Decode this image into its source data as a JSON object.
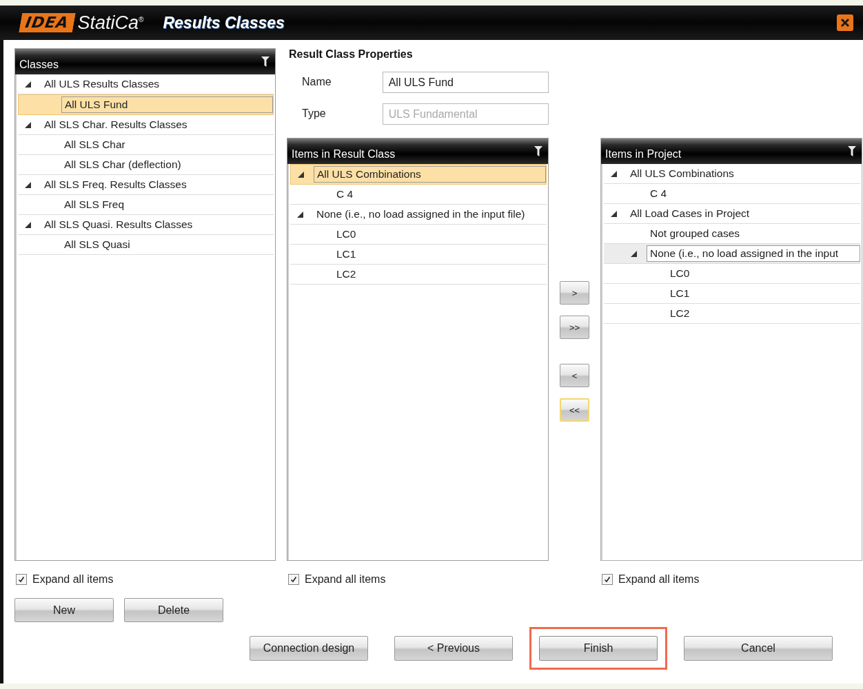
{
  "window": {
    "logo": "IDEA",
    "brand": "StatiCa$^{®}$",
    "title": "Results Classes"
  },
  "classes_panel": {
    "header": "Classes",
    "focused": true,
    "tree": [
      {
        "label": "All ULS Results Classes",
        "expanded": true,
        "selected": false,
        "children": [
          {
            "label": "All ULS Fund",
            "selected": true
          }
        ]
      },
      {
        "label": "All SLS Char. Results Classes",
        "expanded": true,
        "selected": false,
        "children": [
          {
            "label": "All SLS Char",
            "selected": false
          },
          {
            "label": "All SLS Char (deflection)",
            "selected": false
          }
        ]
      },
      {
        "label": "All SLS Freq. Results Classes",
        "expanded": true,
        "selected": false,
        "children": [
          {
            "label": "All SLS Freq",
            "selected": false
          }
        ]
      },
      {
        "label": "All SLS Quasi. Results Classes",
        "expanded": true,
        "selected": false,
        "children": [
          {
            "label": "All SLS Quasi",
            "selected": false
          }
        ]
      }
    ],
    "expand_all": {
      "label": "Expand all items",
      "checked": true
    }
  },
  "properties": {
    "title": "Result Class Properties",
    "fields": [
      {
        "label": "Name",
        "value": "All ULS Fund",
        "disabled": false
      },
      {
        "label": "Type",
        "value": "ULS Fundamental",
        "disabled": true
      }
    ]
  },
  "result_class_panel": {
    "header": "Items in Result Class",
    "focused": true,
    "tree": [
      {
        "label": "All ULS Combinations",
        "expanded": true,
        "selected": true,
        "children": [
          {
            "label": "C 4",
            "selected": false
          }
        ]
      },
      {
        "label": "None (i.e., no load assigned in the input file)",
        "expanded": true,
        "selected": false,
        "children": [
          {
            "label": "LC0",
            "selected": false
          },
          {
            "label": "LC1",
            "selected": false
          },
          {
            "label": "LC2",
            "selected": false
          }
        ]
      }
    ],
    "expand_all": {
      "label": "Expand all items",
      "checked": true
    }
  },
  "move_buttons": [
    {
      "label": ">",
      "hover": false
    },
    {
      "label": ">>",
      "hover": false
    },
    {
      "label": "<",
      "hover": false
    },
    {
      "label": "<<",
      "hover": true
    }
  ],
  "project_panel": {
    "header": "Items in Project",
    "focused": false,
    "tree": [
      {
        "label": "All ULS Combinations",
        "expanded": true,
        "selected": false,
        "children": [
          {
            "label": "C 4",
            "selected": false
          }
        ]
      },
      {
        "label": "All Load Cases in Project",
        "expanded": true,
        "selected": false,
        "children": [
          {
            "label": "Not grouped cases",
            "selected": false
          },
          {
            "label": "None (i.e., no load assigned in the input",
            "expanded": true,
            "selected": true,
            "children": [
              {
                "label": "LC0",
                "selected": false
              },
              {
                "label": "LC1",
                "selected": false
              },
              {
                "label": "LC2",
                "selected": false
              }
            ]
          }
        ]
      }
    ],
    "expand_all": {
      "label": "Expand all items",
      "checked": true
    }
  },
  "class_buttons": [
    "New",
    "Delete"
  ],
  "footer_buttons": [
    {
      "label": "Connection design",
      "highlighted": false
    },
    {
      "label": "< Previous",
      "highlighted": false
    },
    {
      "label": "Finish",
      "highlighted": true
    },
    {
      "label": "Cancel",
      "highlighted": false
    }
  ]
}
